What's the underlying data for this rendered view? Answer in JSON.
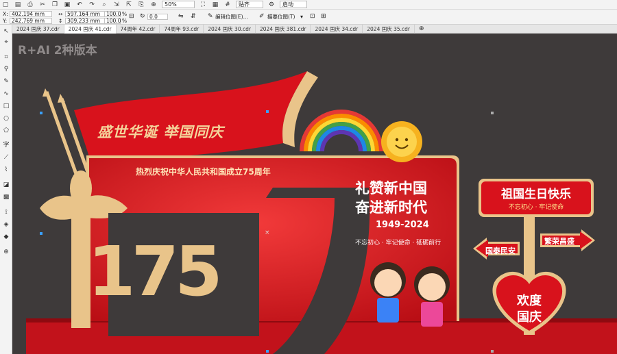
{
  "toolbar": {
    "zoom": "50%",
    "snap_label": "贴齐",
    "launch_label": "启动"
  },
  "props": {
    "x": "402.194 mm",
    "y": "242.769 mm",
    "w": "597.164 mm",
    "h": "309.233 mm",
    "scale_x": "100.0",
    "scale_y": "100.0",
    "pct": "%",
    "angle": "0.0",
    "edit_bitmap": "编辑位图(E)...",
    "trace_bitmap": "描摹位图(T)"
  },
  "tabs": [
    {
      "label": "2024 国庆 37.cdr"
    },
    {
      "label": "2024 国庆 41.cdr"
    },
    {
      "label": "74周年 42.cdr"
    },
    {
      "label": "74周年 93.cdr"
    },
    {
      "label": "2024 国庆 30.cdr"
    },
    {
      "label": "2024 国庆 381.cdr"
    },
    {
      "label": "2024 国庆 34.cdr"
    },
    {
      "label": "2024 国庆 35.cdr"
    }
  ],
  "watermark": "R+AI 2种版本",
  "design": {
    "flag_slogan": "盛世华诞 举国同庆",
    "headline": "热烈庆祝中华人民共和国成立75周年",
    "big_number": "175",
    "praise_1": "礼赞新中国",
    "praise_2": "奋进新时代",
    "years": "1949-2024",
    "motto": "不忘初心 · 牢记使命 · 砥砺前行",
    "sign_top": "祖国生日快乐",
    "sign_sub": "不忘初心 · 牢记使命",
    "arrow_left": "国泰民安",
    "arrow_right": "繁荣昌盛",
    "heart_1": "欢度",
    "heart_2": "国庆"
  },
  "colors": {
    "canvas": "#3e3a3a",
    "red": "#d8121c",
    "gold": "#e9c48a"
  }
}
